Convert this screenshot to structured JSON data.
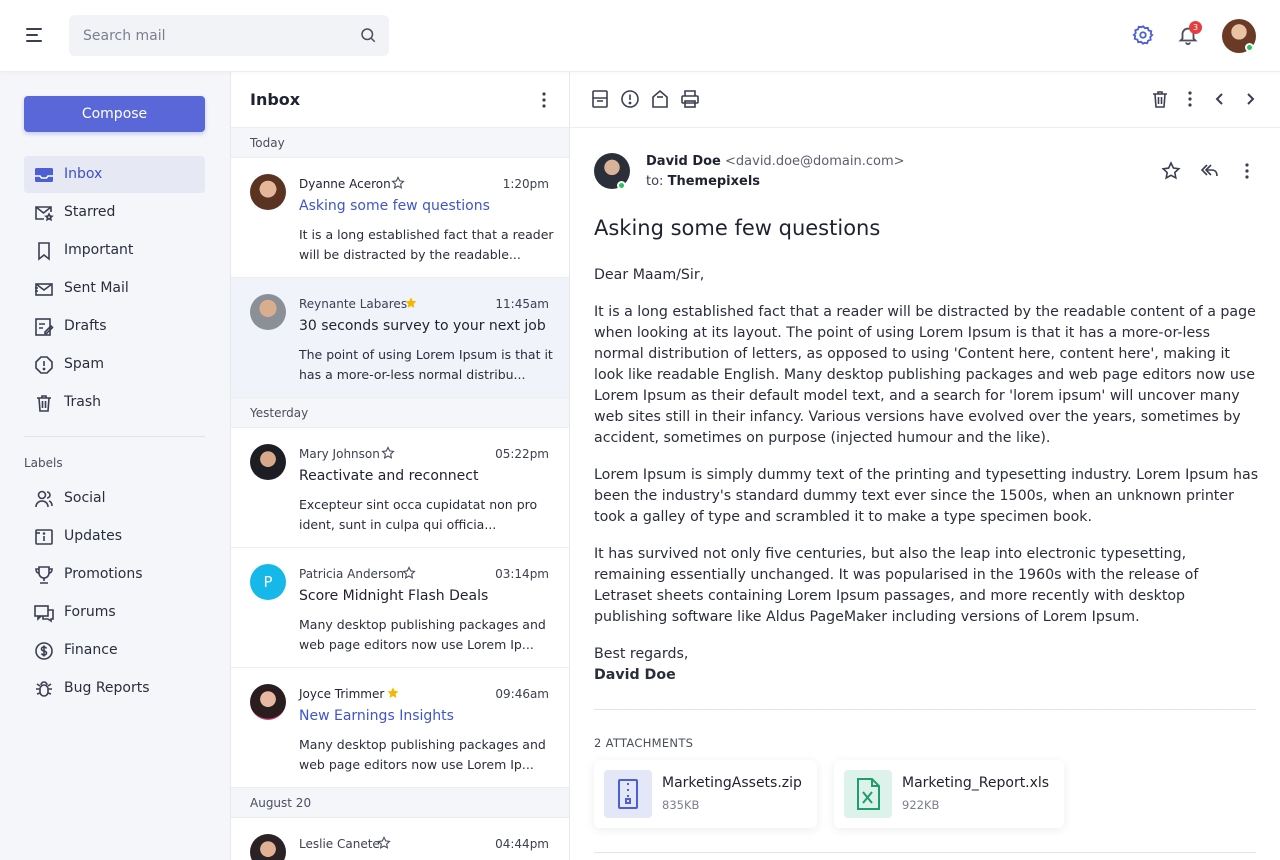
{
  "topbar": {
    "search_placeholder": "Search mail",
    "notifications_count": "3",
    "accent": "#4c5fd5",
    "badge_color": "#e53e3e"
  },
  "sidebar": {
    "compose_label": "Compose",
    "nav": [
      {
        "label": "Inbox",
        "icon": "inbox-icon",
        "active": true
      },
      {
        "label": "Starred",
        "icon": "starred-mail-icon"
      },
      {
        "label": "Important",
        "icon": "bookmark-icon"
      },
      {
        "label": "Sent Mail",
        "icon": "sent-mail-icon"
      },
      {
        "label": "Drafts",
        "icon": "drafts-icon"
      },
      {
        "label": "Spam",
        "icon": "spam-icon"
      },
      {
        "label": "Trash",
        "icon": "trash-icon"
      }
    ],
    "labels_heading": "Labels",
    "labels": [
      {
        "label": "Social",
        "icon": "users-icon"
      },
      {
        "label": "Updates",
        "icon": "info-square-icon"
      },
      {
        "label": "Promotions",
        "icon": "trophy-icon"
      },
      {
        "label": "Forums",
        "icon": "chat-icon"
      },
      {
        "label": "Finance",
        "icon": "dollar-circle-icon"
      },
      {
        "label": "Bug Reports",
        "icon": "bug-icon"
      }
    ]
  },
  "mail_list": {
    "title": "Inbox",
    "groups": [
      "Today",
      "Yesterday",
      "August 20"
    ],
    "mails": [
      {
        "sender": "Dyanne Aceron",
        "starred": false,
        "time": "1:20pm",
        "subject": "Asking some few questions",
        "preview": "It is a long established fact that a reader will be distracted by the readable...",
        "unread": true
      },
      {
        "sender": "Reynante Labares",
        "starred": true,
        "time": "11:45am",
        "subject": "30 seconds survey to your next job",
        "preview": "The point of using Lorem Ipsum is that it has a more-or-less normal distribu...",
        "unread": false
      },
      {
        "sender": "Mary Johnson",
        "starred": false,
        "time": "05:22pm",
        "subject": "Reactivate and reconnect",
        "preview": "Excepteur sint occa cupidatat non pro ident, sunt in culpa qui officia...",
        "unread": false
      },
      {
        "sender": "Patricia Anderson",
        "starred": false,
        "time": "03:14pm",
        "subject": "Score Midnight Flash Deals",
        "preview": "Many desktop publishing packages and web page editors now use Lorem Ip...",
        "unread": false,
        "avatar_letter": "P"
      },
      {
        "sender": "Joyce Trimmer",
        "starred": true,
        "time": "09:46am",
        "subject": "New Earnings Insights",
        "preview": "Many desktop publishing packages and web page editors now use Lorem Ip...",
        "unread": true
      },
      {
        "sender": "Leslie Canete",
        "starred": false,
        "time": "04:44pm"
      }
    ]
  },
  "reader": {
    "from_name": "David Doe",
    "from_email": "<david.doe@domain.com>",
    "to_prefix": "to:",
    "to_name": "Themepixels",
    "subject": "Asking some few questions",
    "greeting": "Dear Maam/Sir,",
    "paragraphs": [
      "It is a long established fact that a reader will be distracted by the readable content of a page when looking at its layout. The point of using Lorem Ipsum is that it has a more-or-less normal distribution of letters, as opposed to using 'Content here, content here', making it look like readable English. Many desktop publishing packages and web page editors now use Lorem Ipsum as their default model text, and a search for 'lorem ipsum' will uncover many web sites still in their infancy. Various versions have evolved over the years, sometimes by accident, sometimes on purpose (injected humour and the like).",
      "Lorem Ipsum is simply dummy text of the printing and typesetting industry. Lorem Ipsum has been the industry's standard dummy text ever since the 1500s, when an unknown printer took a galley of type and scrambled it to make a type specimen book.",
      "It has survived not only five centuries, but also the leap into electronic typesetting, remaining essentially unchanged. It was popularised in the 1960s with the release of Letraset sheets containing Lorem Ipsum passages, and more recently with desktop publishing software like Aldus PageMaker including versions of Lorem Ipsum."
    ],
    "closing": "Best regards,",
    "signature": "David Doe",
    "attachments_heading": "2 ATTACHMENTS",
    "attachments": [
      {
        "name": "MarketingAssets.zip",
        "size": "835KB",
        "icon": "zip-file-icon"
      },
      {
        "name": "Marketing_Report.xls",
        "size": "922KB",
        "icon": "excel-file-icon"
      }
    ]
  }
}
